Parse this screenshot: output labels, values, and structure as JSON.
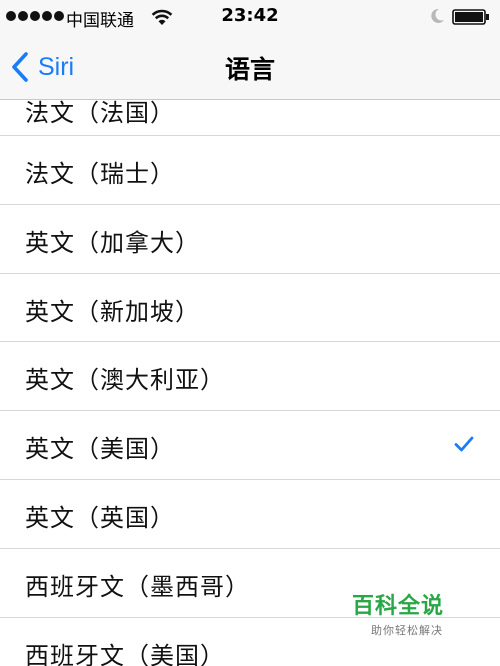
{
  "status_bar": {
    "carrier": "中国联通",
    "time": "23:42"
  },
  "nav": {
    "back_label": "Siri",
    "title": "语言"
  },
  "accent_color": "#1a7cf6",
  "languages": [
    {
      "label": "法文（法国）",
      "selected": false
    },
    {
      "label": "法文（瑞士）",
      "selected": false
    },
    {
      "label": "英文（加拿大）",
      "selected": false
    },
    {
      "label": "英文（新加坡）",
      "selected": false
    },
    {
      "label": "英文（澳大利亚）",
      "selected": false
    },
    {
      "label": "英文（美国）",
      "selected": true
    },
    {
      "label": "英文（英国）",
      "selected": false
    },
    {
      "label": "西班牙文（墨西哥）",
      "selected": false
    },
    {
      "label": "西班牙文（美国）",
      "selected": false
    }
  ],
  "watermark": {
    "title": "百科全说",
    "subtitle": "助你轻松解决"
  }
}
